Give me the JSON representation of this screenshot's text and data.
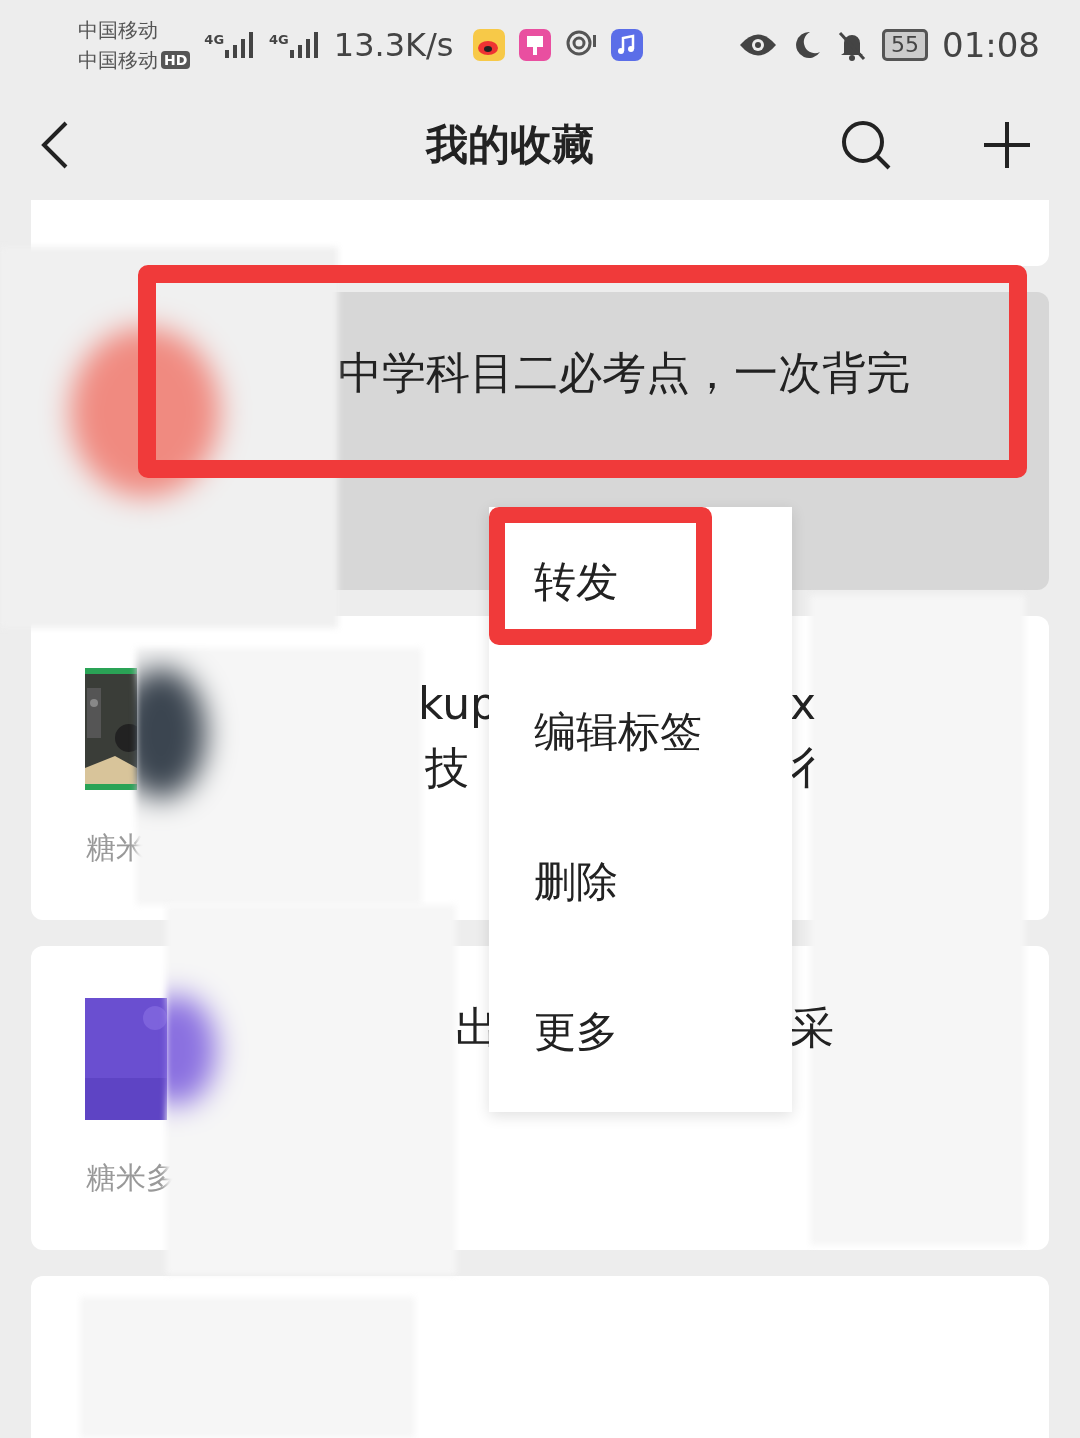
{
  "status_bar": {
    "carrier_1": "中国移动",
    "carrier_2": "中国移动",
    "hd_badge": "HD",
    "network_1": "4G",
    "network_2": "4G",
    "speed": "13.3K/s",
    "battery": "55",
    "time": "01:08"
  },
  "header": {
    "title": "我的收藏"
  },
  "selected_item": {
    "title": "中学科目二必考点，一次背完",
    "selected": true
  },
  "items": [
    {
      "fragments": [
        "kup",
        "技",
        "x",
        "彳"
      ],
      "meta": "糖米"
    },
    {
      "fragments": [
        "出",
        "采"
      ],
      "meta": "糖米多"
    }
  ],
  "menu": [
    {
      "label": "转发",
      "highlighted": true
    },
    {
      "label": "编辑标签",
      "highlighted": false
    },
    {
      "label": "删除",
      "highlighted": false
    },
    {
      "label": "更多",
      "highlighted": false
    }
  ]
}
